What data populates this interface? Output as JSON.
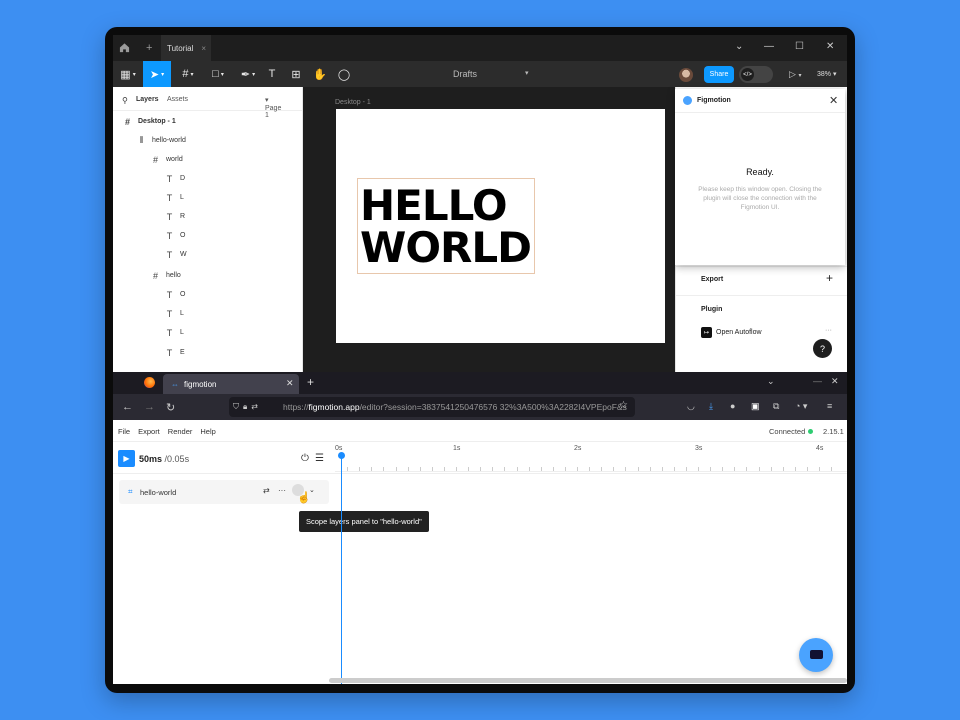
{
  "figma": {
    "tab_title": "Tutorial",
    "tab_close": "×",
    "new_tab": "+",
    "window_controls": {
      "chevron": "⌄",
      "minimize": "—",
      "maximize": "☐",
      "close": "✕"
    },
    "toolbar": {
      "location": "Drafts",
      "share_label": "Share",
      "zoom": "38%",
      "dev_mode_icon": "</>"
    },
    "layers_panel": {
      "tab_layers": "Layers",
      "tab_assets": "Assets",
      "page_selector": "Page 1",
      "items": [
        {
          "icon": "#",
          "label": "Desktop - 1"
        },
        {
          "icon": "#",
          "label": "hello-world"
        },
        {
          "icon": "#",
          "label": "world"
        },
        {
          "icon": "T",
          "label": "D"
        },
        {
          "icon": "T",
          "label": "L"
        },
        {
          "icon": "T",
          "label": "R"
        },
        {
          "icon": "T",
          "label": "O"
        },
        {
          "icon": "T",
          "label": "W"
        },
        {
          "icon": "#",
          "label": "hello"
        },
        {
          "icon": "T",
          "label": "O"
        },
        {
          "icon": "T",
          "label": "L"
        },
        {
          "icon": "T",
          "label": "L"
        },
        {
          "icon": "T",
          "label": "E"
        }
      ]
    },
    "canvas": {
      "frame_label": "Desktop - 1",
      "text_line1": "HELLO",
      "text_line2": "WORLD"
    },
    "right_panel": {
      "export_label": "Export",
      "export_add": "+",
      "plugin_label": "Plugin",
      "plugin_item": "Open Autoflow",
      "plugin_more": "···",
      "help": "?"
    },
    "plugin_window": {
      "title": "Figmotion",
      "close": "✕",
      "status": "Ready.",
      "note": "Please keep this window open. Closing the plugin will close the connection with the Figmotion UI."
    }
  },
  "browser": {
    "tab_title": "figmotion",
    "tab_close": "✕",
    "new_tab": "+",
    "window_controls": {
      "chevron": "⌄",
      "minimize": "—",
      "close": "✕"
    },
    "url_scheme": "https://",
    "url_host": "figmotion.app",
    "url_path": "/editor?session=3837541250476576 32%3A500%3A2282I4VPEpoF&s"
  },
  "app": {
    "menu": [
      "File",
      "Export",
      "Render",
      "Help"
    ],
    "status": "Connected",
    "version": "2.15.1",
    "time_current": "50ms",
    "time_total": "/0.05s",
    "ruler_ticks": [
      "0s",
      "1s",
      "2s",
      "3s",
      "4s"
    ],
    "track_name": "hello-world",
    "tooltip": "Scope layers panel to \"hello-world\""
  }
}
